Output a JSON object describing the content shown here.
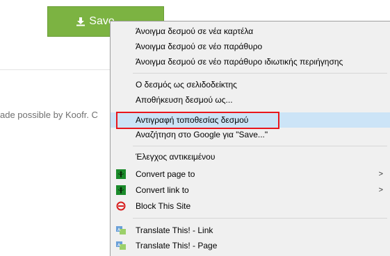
{
  "save_button": {
    "label": "Save",
    "icon": "download-icon",
    "color": "#7cb342"
  },
  "footer": {
    "text": "ade possible by Koofr. C"
  },
  "context_menu": {
    "items": [
      {
        "label": "Άνοιγμα δεσμού σε νέα καρτέλα"
      },
      {
        "label": "Άνοιγμα δεσμού σε νέο παράθυρο"
      },
      {
        "label": "Άνοιγμα δεσμού σε νέο παράθυρο ιδιωτικής περιήγησης"
      },
      {
        "label": "Ο δεσμός ως σελιδοδείκτης"
      },
      {
        "label": "Αποθήκευση δεσμού ως..."
      },
      {
        "label": "Αντιγραφή τοποθεσίας δεσμού",
        "highlighted": true
      },
      {
        "label": "Αναζήτηση στο Google για \"Save...\""
      },
      {
        "label": "Έλεγχος αντικειμένου"
      },
      {
        "label": "Convert page to",
        "icon": "convert-icon",
        "submenu": true
      },
      {
        "label": "Convert link to",
        "icon": "convert-icon",
        "submenu": true
      },
      {
        "label": "Block This Site",
        "icon": "block-icon"
      },
      {
        "label": "Translate This! - Link",
        "icon": "translate-icon"
      },
      {
        "label": "Translate This! - Page",
        "icon": "translate-icon"
      }
    ],
    "submenu_arrow": ">",
    "highlight_border_color": "#e8161c"
  }
}
